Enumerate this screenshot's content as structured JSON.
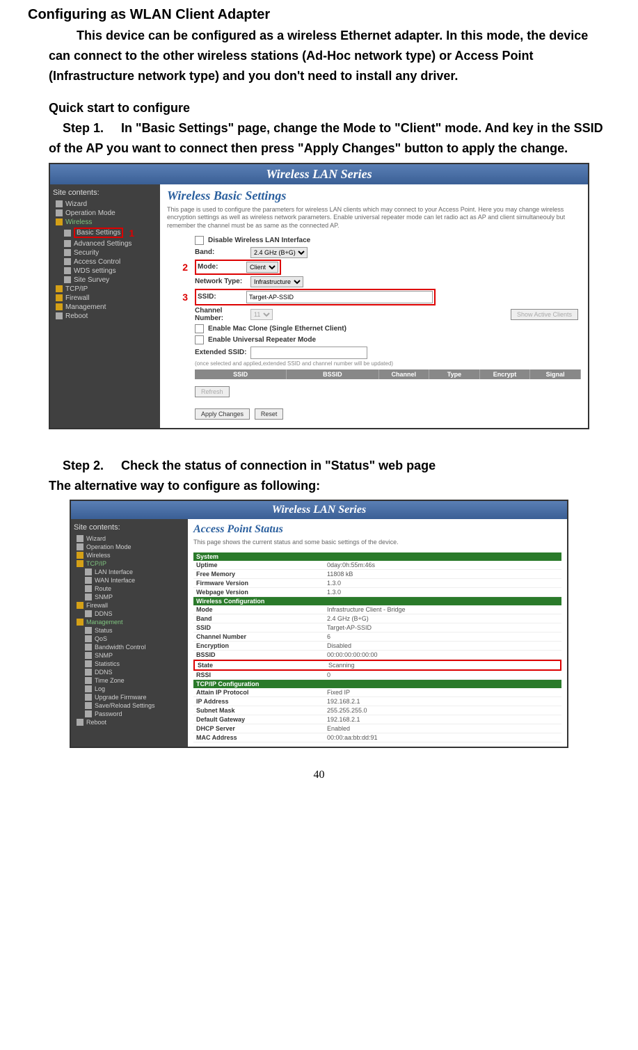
{
  "title": "Configuring as WLAN Client Adapter",
  "intro": "This device can be configured as a wireless Ethernet adapter. In this mode, the device can connect to the other wireless stations (Ad-Hoc network type) or Access Point (Infrastructure network type) and you don't need to install any driver.",
  "quick_start": "Quick start to configure",
  "step1_label": "Step 1.",
  "step1_text": "In \"Basic Settings\" page, change the Mode to \"Client\" mode. And key in the SSID of the AP you want to connect then press \"Apply Changes\" button to apply the change.",
  "step2_label": "Step 2.",
  "step2_text": "Check the status of connection in \"Status\" web page",
  "alt_text": "The alternative way to configure as following:",
  "page_num": "40",
  "sc1": {
    "banner": "Wireless LAN Series",
    "sidebar_title": "Site contents:",
    "sidebar": [
      "Wizard",
      "Operation Mode",
      "Wireless",
      "Basic Settings",
      "Advanced Settings",
      "Security",
      "Access Control",
      "WDS settings",
      "Site Survey",
      "TCP/IP",
      "Firewall",
      "Management",
      "Reboot"
    ],
    "markers": {
      "m1": "1",
      "m2": "2",
      "m3": "3"
    },
    "panel_title": "Wireless Basic Settings",
    "panel_desc": "This page is used to configure the parameters for wireless LAN clients which may connect to your Access Point. Here you may change wireless encryption settings as well as wireless network parameters. Enable universal repeater mode can let radio act as AP and client simultaneouly but remember the channel must be as same as the connected AP.",
    "disable_label": "Disable Wireless LAN Interface",
    "band_label": "Band:",
    "band_value": "2.4 GHz (B+G)",
    "mode_label": "Mode:",
    "mode_value": "Client",
    "network_type_label": "Network Type:",
    "network_type_value": "Infrastructure",
    "ssid_label": "SSID:",
    "ssid_value": "Target-AP-SSID",
    "channel_label": "Channel Number:",
    "channel_value": "11",
    "show_clients_btn": "Show Active Clients",
    "mac_clone_label": "Enable Mac Clone (Single Ethernet Client)",
    "universal_label": "Enable Universal Repeater Mode",
    "ext_ssid_label": "Extended SSID:",
    "ext_note": "(once selected and applied,extended SSID and channel number will be updated)",
    "tbl": [
      "SSID",
      "BSSID",
      "Channel",
      "Type",
      "Encrypt",
      "Signal"
    ],
    "refresh_btn": "Refresh",
    "apply_btn": "Apply Changes",
    "reset_btn": "Reset"
  },
  "sc2": {
    "banner": "Wireless LAN Series",
    "sidebar_title": "Site contents:",
    "sidebar": [
      "Wizard",
      "Operation Mode",
      "Wireless",
      "TCP/IP",
      "LAN Interface",
      "WAN Interface",
      "Route",
      "SNMP",
      "Firewall",
      "DDNS",
      "Management",
      "Status",
      "QoS",
      "Bandwidth Control",
      "SNMP",
      "Statistics",
      "DDNS",
      "Time Zone",
      "Log",
      "Upgrade Firmware",
      "Save/Reload Settings",
      "Password",
      "Reboot"
    ],
    "panel_title": "Access Point Status",
    "panel_desc": "This page shows the current status and some basic settings of the device.",
    "sections": {
      "system": "System",
      "wireless": "Wireless Configuration",
      "tcpip": "TCP/IP Configuration"
    },
    "rows": {
      "uptime_k": "Uptime",
      "uptime_v": "0day:0h:55m:46s",
      "freemem_k": "Free Memory",
      "freemem_v": "11808 kB",
      "fwver_k": "Firmware Version",
      "fwver_v": "1.3.0",
      "webver_k": "Webpage Version",
      "webver_v": "1.3.0",
      "mode_k": "Mode",
      "mode_v": "Infrastructure Client - Bridge",
      "band_k": "Band",
      "band_v": "2.4 GHz (B+G)",
      "ssid_k": "SSID",
      "ssid_v": "Target-AP-SSID",
      "chan_k": "Channel Number",
      "chan_v": "6",
      "enc_k": "Encryption",
      "enc_v": "Disabled",
      "bssid_k": "BSSID",
      "bssid_v": "00:00:00:00:00:00",
      "state_k": "State",
      "state_v": "Scanning",
      "rssi_k": "RSSI",
      "rssi_v": "0",
      "attain_k": "Attain IP Protocol",
      "attain_v": "Fixed IP",
      "ip_k": "IP Address",
      "ip_v": "192.168.2.1",
      "subnet_k": "Subnet Mask",
      "subnet_v": "255.255.255.0",
      "gw_k": "Default Gateway",
      "gw_v": "192.168.2.1",
      "dhcp_k": "DHCP Server",
      "dhcp_v": "Enabled",
      "mac_k": "MAC Address",
      "mac_v": "00:00:aa:bb:dd:91"
    }
  }
}
